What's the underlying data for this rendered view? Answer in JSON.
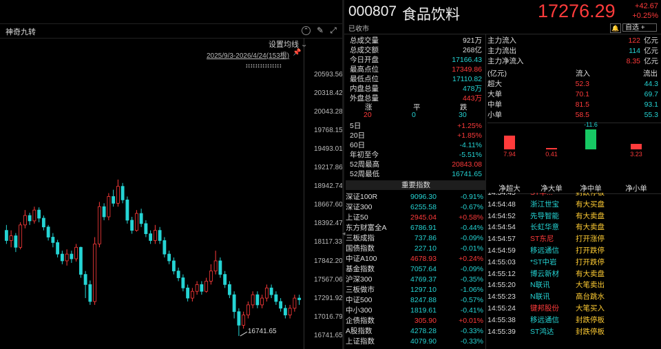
{
  "chart": {
    "title": "神奇九转",
    "settings_label": "设置均线",
    "range_label": "2025/9/3-2026/4/24(153根)",
    "markers": "↕↕↕↕↕↕↕↕↕↕↕↕↕↕↕",
    "low_label": "16741.65",
    "price_ticks": [
      "20593.56",
      "20318.42",
      "20043.28",
      "19768.15",
      "19493.01",
      "19217.86",
      "18942.74",
      "18667.60",
      "18392.47",
      "18117.33",
      "17842.20",
      "17567.06",
      "17291.92",
      "17016.79",
      "16741.65"
    ],
    "candles": [
      [
        18300,
        18150,
        18380,
        18100
      ],
      [
        18150,
        18220,
        18300,
        18050
      ],
      [
        18220,
        18050,
        18260,
        17980
      ],
      [
        18050,
        18380,
        18420,
        18020
      ],
      [
        18380,
        18520,
        18600,
        18330
      ],
      [
        18520,
        18440,
        18560,
        18380
      ],
      [
        18440,
        18600,
        18650,
        18400
      ],
      [
        18600,
        18480,
        18640,
        18420
      ],
      [
        18480,
        18350,
        18520,
        18300
      ],
      [
        18350,
        18200,
        18380,
        18150
      ],
      [
        18200,
        18120,
        18260,
        18050
      ],
      [
        18120,
        17950,
        18160,
        17900
      ],
      [
        17950,
        17850,
        18000,
        17800
      ],
      [
        17850,
        17950,
        18020,
        17780
      ],
      [
        17950,
        17880,
        18000,
        17820
      ],
      [
        17880,
        18050,
        18100,
        17840
      ],
      [
        18050,
        17650,
        18060,
        17600
      ],
      [
        17650,
        17500,
        17700,
        17300
      ],
      [
        17500,
        17250,
        17560,
        17200
      ],
      [
        17250,
        18100,
        18200,
        17200
      ],
      [
        18100,
        18650,
        18720,
        18050
      ],
      [
        18650,
        18500,
        18700,
        18450
      ],
      [
        18500,
        18800,
        18850,
        18450
      ],
      [
        18800,
        18700,
        18900,
        18650
      ],
      [
        18700,
        18950,
        19050,
        18650
      ],
      [
        18950,
        18750,
        19000,
        18700
      ],
      [
        18750,
        18450,
        18800,
        18400
      ],
      [
        18450,
        18300,
        18500,
        18250
      ],
      [
        18300,
        18550,
        18600,
        18280
      ],
      [
        18550,
        18400,
        18620,
        18350
      ],
      [
        18400,
        18250,
        18450,
        18200
      ],
      [
        18250,
        18150,
        18300,
        18100
      ],
      [
        18150,
        18300,
        18380,
        18100
      ],
      [
        18300,
        18150,
        18350,
        18100
      ],
      [
        18150,
        17950,
        18200,
        17900
      ],
      [
        17950,
        17850,
        18000,
        17800
      ],
      [
        17850,
        17700,
        17900,
        17650
      ],
      [
        17700,
        17600,
        17750,
        17550
      ],
      [
        17600,
        17450,
        17650,
        17400
      ],
      [
        17450,
        17300,
        17500,
        17250
      ],
      [
        17300,
        17400,
        17450,
        17250
      ],
      [
        17400,
        17500,
        17550,
        17350
      ],
      [
        17500,
        17400,
        17550,
        17350
      ],
      [
        17400,
        17550,
        17600,
        17380
      ],
      [
        17550,
        17700,
        17800,
        17500
      ],
      [
        17700,
        17850,
        18000,
        17650
      ],
      [
        17850,
        17650,
        17900,
        17600
      ],
      [
        17650,
        17500,
        17700,
        17450
      ],
      [
        17500,
        17350,
        17550,
        17300
      ],
      [
        17350,
        17100,
        17400,
        17000
      ],
      [
        17100,
        16900,
        17150,
        16741
      ],
      [
        16900,
        17050,
        17100,
        16850
      ],
      [
        17050,
        17200,
        17250,
        17000
      ],
      [
        17200,
        17350,
        17400,
        17150
      ],
      [
        17350,
        17200,
        17400,
        17150
      ],
      [
        17200,
        17300,
        17350,
        17150
      ],
      [
        17300,
        17450,
        17500,
        17250
      ],
      [
        17450,
        17350,
        17500,
        17300
      ],
      [
        17350,
        17250,
        17400,
        17200
      ],
      [
        17250,
        17150,
        17300,
        17100
      ],
      [
        17150,
        17050,
        17200,
        17000
      ],
      [
        17050,
        17150,
        17200,
        17000
      ],
      [
        17150,
        17300,
        17350,
        17100
      ],
      [
        17300,
        17276,
        17350,
        17200
      ]
    ]
  },
  "quote": {
    "code": "000807",
    "name": "食品饮料",
    "status": "已收市",
    "price": "17276.29",
    "change": "+42.67",
    "change_pct": "+0.25%",
    "fav_label": "自选 +"
  },
  "stats": [
    {
      "label": "总成交量",
      "value": "921万",
      "color": "white"
    },
    {
      "label": "总成交额",
      "value": "268亿",
      "color": "white"
    },
    {
      "label": "今日开盘",
      "value": "17166.43",
      "color": "green"
    },
    {
      "label": "最高点位",
      "value": "17349.86",
      "color": "red"
    },
    {
      "label": "最低点位",
      "value": "17110.82",
      "color": "green"
    },
    {
      "label": "内盘总量",
      "value": "478万",
      "color": "green"
    },
    {
      "label": "外盘总量",
      "value": "443万",
      "color": "red"
    }
  ],
  "updown": {
    "headers": [
      "涨",
      "平",
      "跌"
    ],
    "values": [
      "20",
      "0",
      "30"
    ]
  },
  "periods": [
    {
      "label": "5日",
      "value": "+1.25%",
      "color": "red"
    },
    {
      "label": "20日",
      "value": "+1.85%",
      "color": "red"
    },
    {
      "label": "60日",
      "value": "-4.11%",
      "color": "green"
    },
    {
      "label": "年初至今",
      "value": "-5.51%",
      "color": "green"
    },
    {
      "label": "52周最高",
      "value": "20843.08",
      "color": "red"
    },
    {
      "label": "52周最低",
      "value": "16741.65",
      "color": "green"
    }
  ],
  "main_flow": [
    {
      "label": "主力流入",
      "value": "122",
      "unit": "亿元",
      "color": "red"
    },
    {
      "label": "主力流出",
      "value": "114",
      "unit": "亿元",
      "color": "green"
    },
    {
      "label": "主力净流入",
      "value": "8.35",
      "unit": "亿元",
      "color": "red"
    }
  ],
  "flow_table": {
    "headers": [
      "(亿元)",
      "流入",
      "流出"
    ],
    "rows": [
      {
        "label": "超大",
        "in": "52.3",
        "out": "44.3"
      },
      {
        "label": "大单",
        "in": "70.1",
        "out": "69.7"
      },
      {
        "label": "中单",
        "in": "81.5",
        "out": "93.1"
      },
      {
        "label": "小单",
        "in": "58.5",
        "out": "55.3"
      }
    ]
  },
  "net_flow": {
    "categories": [
      "净超大",
      "净大单",
      "净中单",
      "净小单"
    ],
    "values": [
      7.94,
      0.41,
      -11.6,
      3.23
    ],
    "labels": [
      "7.94",
      "0.41",
      "-11.6",
      "3.23"
    ]
  },
  "indices_header": "重要指数",
  "indices": [
    {
      "name": "深证100R",
      "value": "9096.30",
      "pct": "-0.91%",
      "color": "green"
    },
    {
      "name": "深证300",
      "value": "6255.58",
      "pct": "-0.67%",
      "color": "green"
    },
    {
      "name": "上证50",
      "value": "2945.04",
      "pct": "+0.58%",
      "color": "red"
    },
    {
      "name": "东方财富全A",
      "value": "6786.91",
      "pct": "-0.44%",
      "color": "green"
    },
    {
      "name": "三板成指",
      "value": "737.86",
      "pct": "-0.09%",
      "color": "green"
    },
    {
      "name": "国债指数",
      "value": "227.10",
      "pct": "-0.01%",
      "color": "green"
    },
    {
      "name": "中证A100",
      "value": "4678.93",
      "pct": "+0.24%",
      "color": "red"
    },
    {
      "name": "基金指数",
      "value": "7057.64",
      "pct": "-0.09%",
      "color": "green"
    },
    {
      "name": "沪深300",
      "value": "4769.37",
      "pct": "-0.35%",
      "color": "green"
    },
    {
      "name": "三板做市",
      "value": "1297.10",
      "pct": "-1.06%",
      "color": "green"
    },
    {
      "name": "中证500",
      "value": "8247.88",
      "pct": "-0.57%",
      "color": "green"
    },
    {
      "name": "中小300",
      "value": "1819.61",
      "pct": "-0.41%",
      "color": "green"
    },
    {
      "name": "企债指数",
      "value": "305.90",
      "pct": "+0.01%",
      "color": "red"
    },
    {
      "name": "A股指数",
      "value": "4278.28",
      "pct": "-0.33%",
      "color": "green"
    },
    {
      "name": "上证指数",
      "value": "4079.90",
      "pct": "-0.33%",
      "color": "green"
    }
  ],
  "ticks": [
    {
      "time": "14:54:45",
      "name": "ST华...",
      "event": "封跌停板",
      "ncolor": "red"
    },
    {
      "time": "14:54:48",
      "name": "浙江世宝",
      "event": "有大买盘",
      "ncolor": "green"
    },
    {
      "time": "14:54:52",
      "name": "先导智能",
      "event": "有大卖盘",
      "ncolor": "green"
    },
    {
      "time": "14:54:54",
      "name": "长虹华意",
      "event": "有大卖盘",
      "ncolor": "green"
    },
    {
      "time": "14:54:57",
      "name": "ST东尼",
      "event": "打开涨停",
      "ncolor": "red"
    },
    {
      "time": "14:54:59",
      "name": "移远通信",
      "event": "打开跌停",
      "ncolor": "green"
    },
    {
      "time": "14:55:03",
      "name": "*ST中岩",
      "event": "打开跌停",
      "ncolor": "green"
    },
    {
      "time": "14:55:12",
      "name": "博云新材",
      "event": "有大卖盘",
      "ncolor": "green"
    },
    {
      "time": "14:55:20",
      "name": "N联讯",
      "event": "大笔卖出",
      "ncolor": "green"
    },
    {
      "time": "14:55:23",
      "name": "N联讯",
      "event": "高台跳水",
      "ncolor": "green"
    },
    {
      "time": "14:55:24",
      "name": "键邦股份",
      "event": "大笔买入",
      "ncolor": "red"
    },
    {
      "time": "14:55:38",
      "name": "移远通信",
      "event": "封跌停板",
      "ncolor": "green"
    },
    {
      "time": "14:55:39",
      "name": "ST鸿达",
      "event": "封跌停板",
      "ncolor": "green"
    }
  ],
  "colors": {
    "up": "#ff3b3b",
    "down": "#25d4d4",
    "bg": "#000000"
  }
}
